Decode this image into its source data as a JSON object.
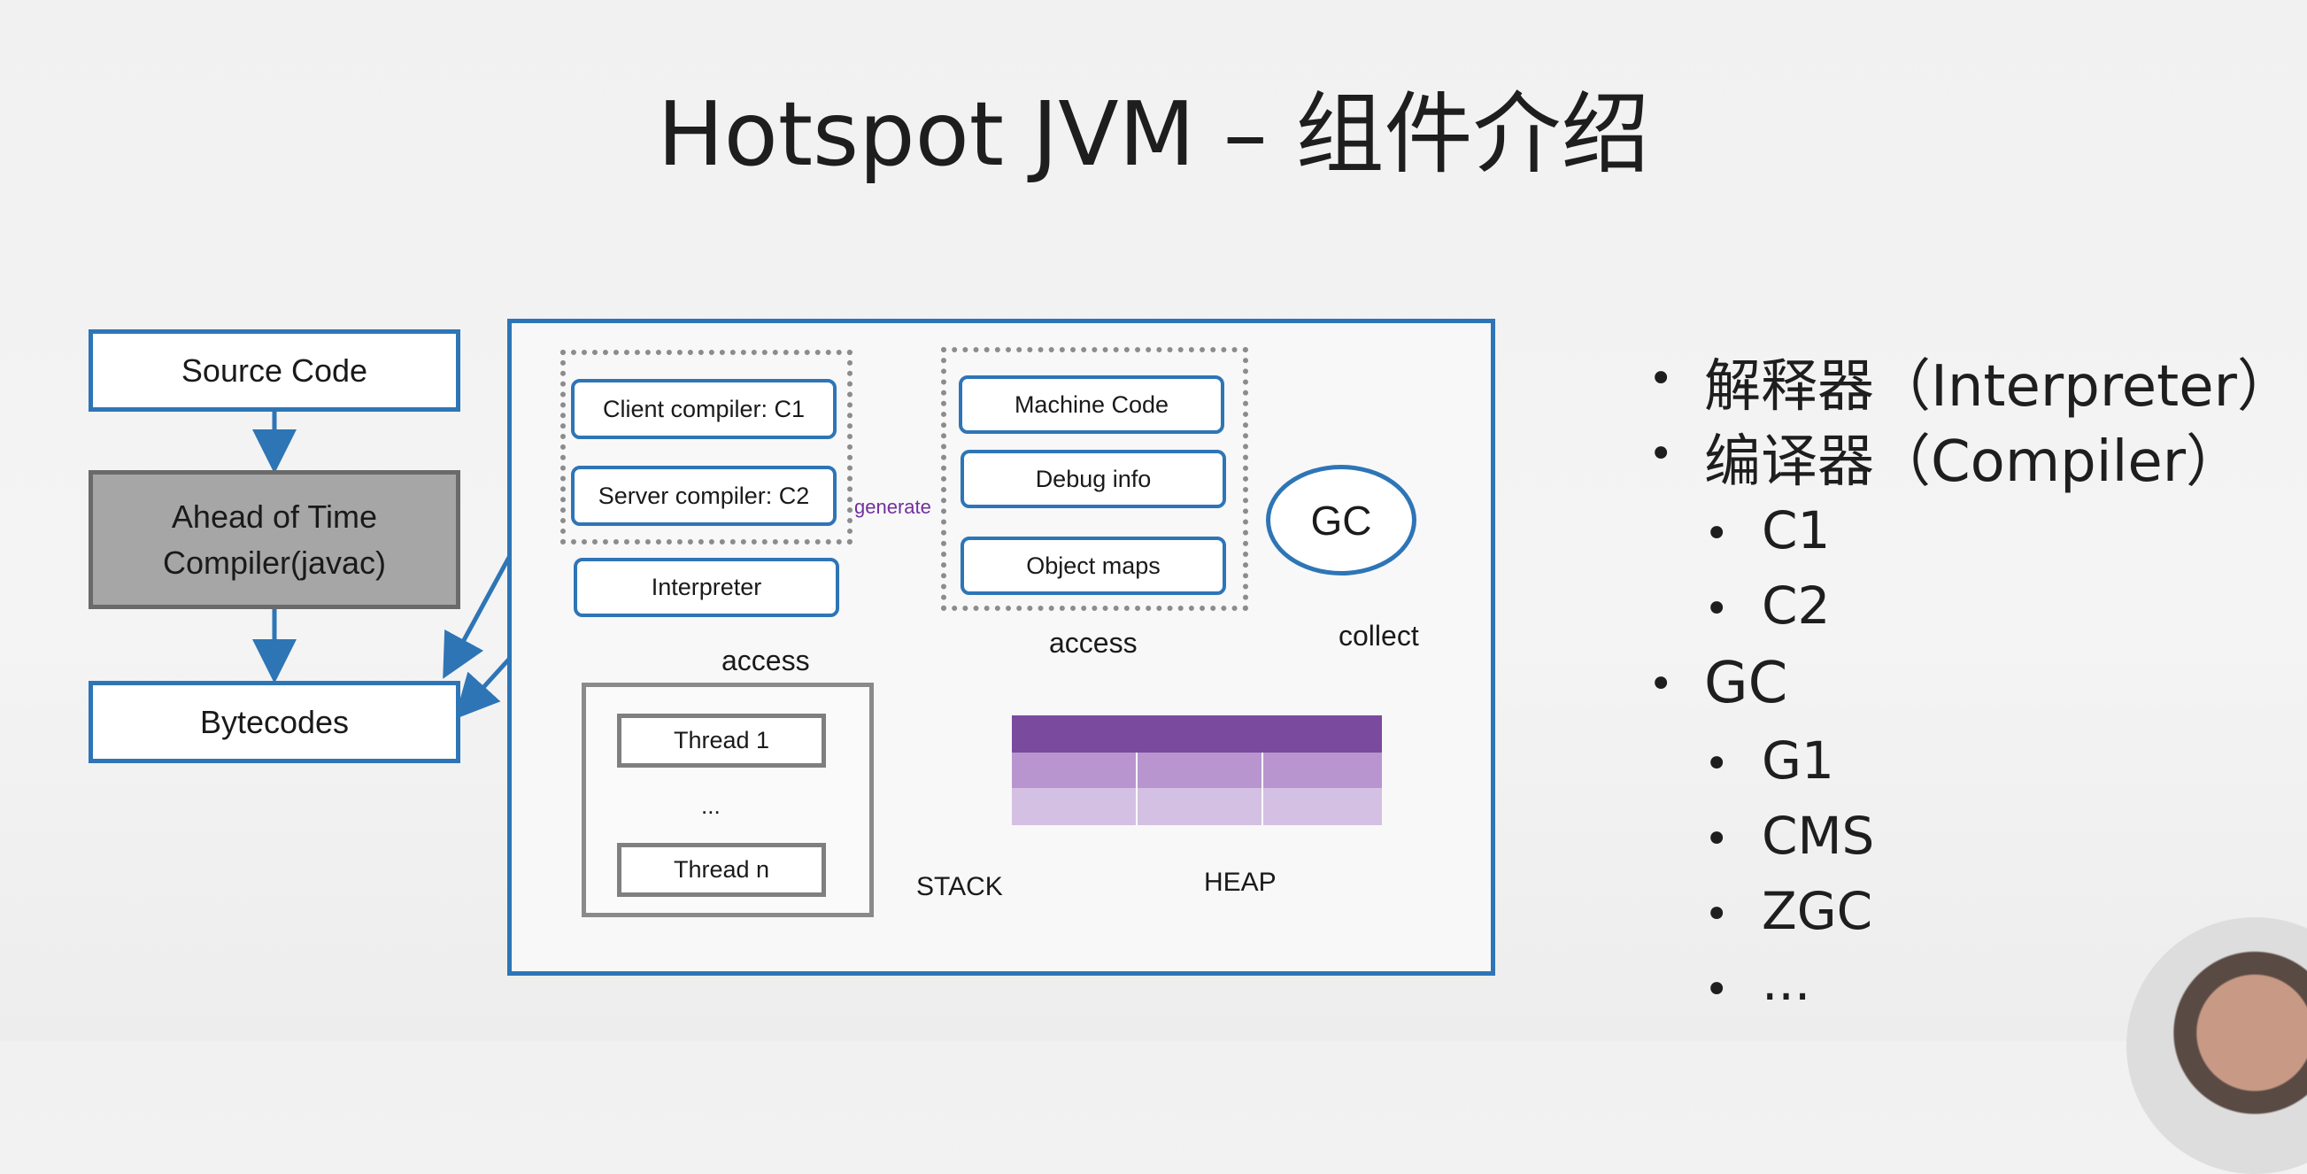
{
  "title": "Hotspot JVM – 组件介绍",
  "left": {
    "source_code": "Source Code",
    "aot_line1": "Ahead of Time",
    "aot_line2": "Compiler(javac)",
    "bytecodes": "Bytecodes"
  },
  "jvm": {
    "client_compiler": "Client compiler: C1",
    "server_compiler": "Server compiler: C2",
    "generate": "generate",
    "interpreter": "Interpreter",
    "machine_code": "Machine Code",
    "debug_info": "Debug info",
    "object_maps": "Object maps",
    "gc": "GC",
    "collect": "collect",
    "access_stack": "access",
    "access_heap": "access",
    "thread1": "Thread 1",
    "ellipsis": "...",
    "threadn": "Thread n",
    "stack": "STACK",
    "heap": "HEAP"
  },
  "colors": {
    "border_blue": "#2e75b6",
    "heap_dark": "#7a4a9f",
    "heap_mid": "#b895cf",
    "heap_light": "#d4c0e2",
    "generate_text": "#7030a0"
  },
  "list": {
    "interpreter": "解释器（Interpreter）",
    "compiler": "编译器（Compiler）",
    "c1": "C1",
    "c2": "C2",
    "gc": "GC",
    "g1": "G1",
    "cms": "CMS",
    "zgc": "ZGC",
    "more": "..."
  }
}
